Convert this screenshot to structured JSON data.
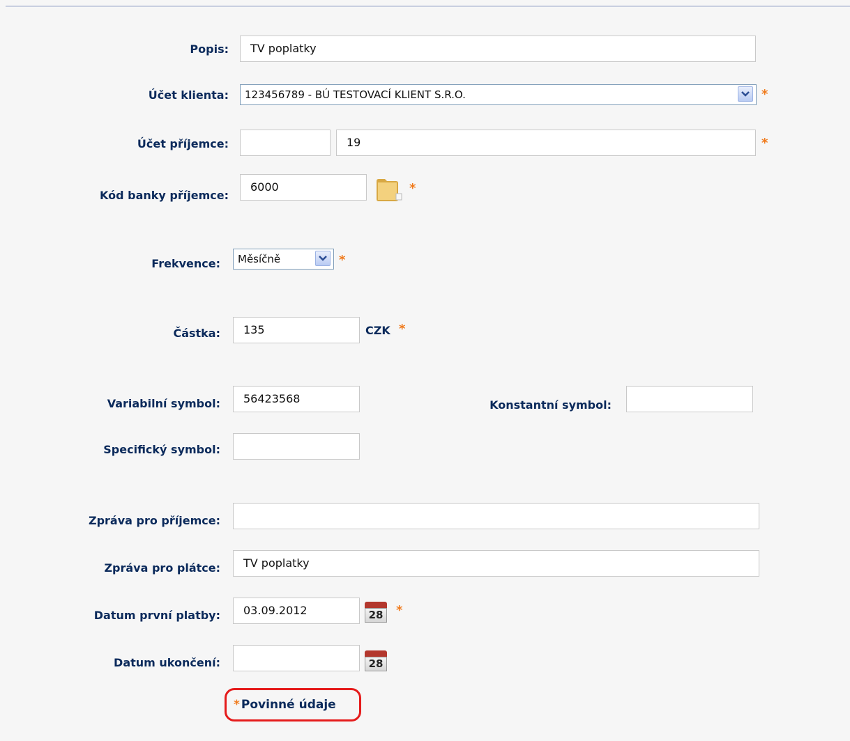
{
  "form": {
    "popis": {
      "label": "Popis:",
      "value": "TV poplatky"
    },
    "ucet_klienta": {
      "label": "Účet klienta:",
      "value": "123456789 - BÚ TESTOVACÍ KLIENT S.R.O."
    },
    "ucet_prijemce": {
      "label": "Účet příjemce:",
      "prefix": "",
      "number": "19"
    },
    "kod_banky": {
      "label": "Kód banky příjemce:",
      "value": "6000",
      "icon": "folder-icon"
    },
    "frekvence": {
      "label": "Frekvence:",
      "value": "Měsíčně"
    },
    "castka": {
      "label": "Částka:",
      "value": "135",
      "currency": "CZK"
    },
    "variabilni_symbol": {
      "label": "Variabilní symbol:",
      "value": "56423568"
    },
    "konstantni_symbol": {
      "label": "Konstantní symbol:",
      "value": ""
    },
    "specificky_symbol": {
      "label": "Specifický symbol:",
      "value": ""
    },
    "zprava_prijemce": {
      "label": "Zpráva pro příjemce:",
      "value": ""
    },
    "zprava_platce": {
      "label": "Zpráva pro plátce:",
      "value": "TV poplatky"
    },
    "datum_prvni_platby": {
      "label": "Datum první platby:",
      "value": "03.09.2012",
      "calendar_day": "28"
    },
    "datum_ukonceni": {
      "label": "Datum ukončení:",
      "value": "",
      "calendar_day": "28"
    },
    "required_marker": "*",
    "required_note": "Povinné údaje"
  },
  "colors": {
    "label": "#0b2a5b",
    "required": "#f07a1b",
    "highlight": "#e51b1b",
    "background": "#f6f6f6"
  }
}
